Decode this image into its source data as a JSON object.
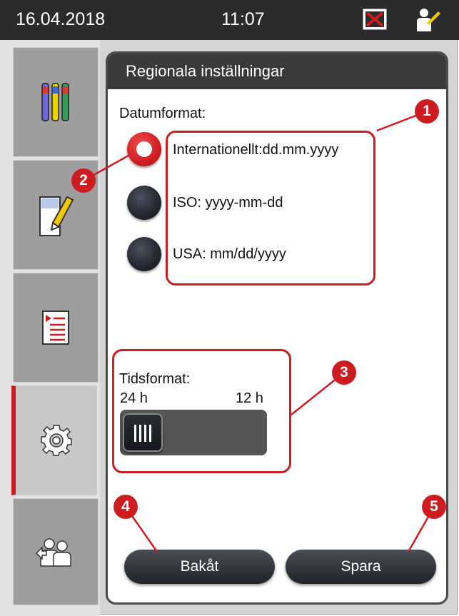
{
  "status_bar": {
    "date": "16.04.2018",
    "time": "11:07",
    "error_icon": "error-x-icon",
    "user_icon": "user-icon"
  },
  "sidebar": {
    "items": [
      {
        "name": "reagents",
        "icon": "reagent-bottles-icon"
      },
      {
        "name": "slides",
        "icon": "slide-edit-icon"
      },
      {
        "name": "programs",
        "icon": "program-list-icon"
      },
      {
        "name": "settings",
        "icon": "gear-icon",
        "active": true
      },
      {
        "name": "user",
        "icon": "user-switch-icon"
      }
    ]
  },
  "panel": {
    "title": "Regionala inställningar",
    "date_format": {
      "label": "Datumformat:",
      "options": [
        {
          "label": "Internationellt:dd.mm.yyyy",
          "selected": true
        },
        {
          "label": "ISO: yyyy-mm-dd",
          "selected": false
        },
        {
          "label": "USA: mm/dd/yyyy",
          "selected": false
        }
      ]
    },
    "time_format": {
      "label": "Tidsformat:",
      "left_label": "24 h",
      "right_label": "12 h",
      "selected": "24 h"
    },
    "buttons": {
      "back": "Bakåt",
      "save": "Spara"
    }
  },
  "annotations": [
    "1",
    "2",
    "3",
    "4",
    "5"
  ],
  "colors": {
    "accent": "#cc1c20",
    "header": "#2b2b2b"
  }
}
